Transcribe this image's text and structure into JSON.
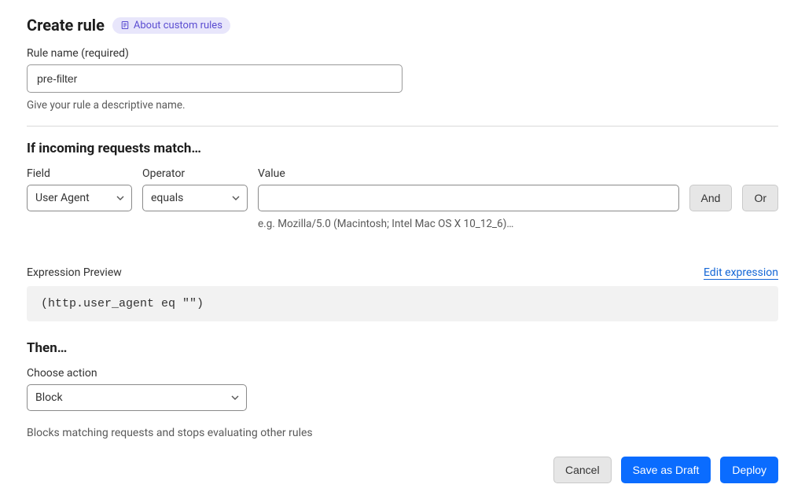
{
  "header": {
    "title": "Create rule",
    "about_link": "About custom rules"
  },
  "rule_name": {
    "label": "Rule name (required)",
    "value": "pre-filter",
    "helper": "Give your rule a descriptive name."
  },
  "condition": {
    "title": "If incoming requests match…",
    "labels": {
      "field": "Field",
      "operator": "Operator",
      "value": "Value"
    },
    "field_selected": "User Agent",
    "operator_selected": "equals",
    "value": "",
    "value_placeholder": "",
    "value_hint": "e.g. Mozilla/5.0 (Macintosh; Intel Mac OS X 10_12_6)…",
    "and_label": "And",
    "or_label": "Or"
  },
  "expression": {
    "label": "Expression Preview",
    "edit_label": "Edit expression",
    "code": "(http.user_agent eq \"\")"
  },
  "then": {
    "title": "Then…",
    "choose_action_label": "Choose action",
    "action_selected": "Block",
    "action_desc": "Blocks matching requests and stops evaluating other rules"
  },
  "footer": {
    "cancel": "Cancel",
    "save_draft": "Save as Draft",
    "deploy": "Deploy"
  }
}
